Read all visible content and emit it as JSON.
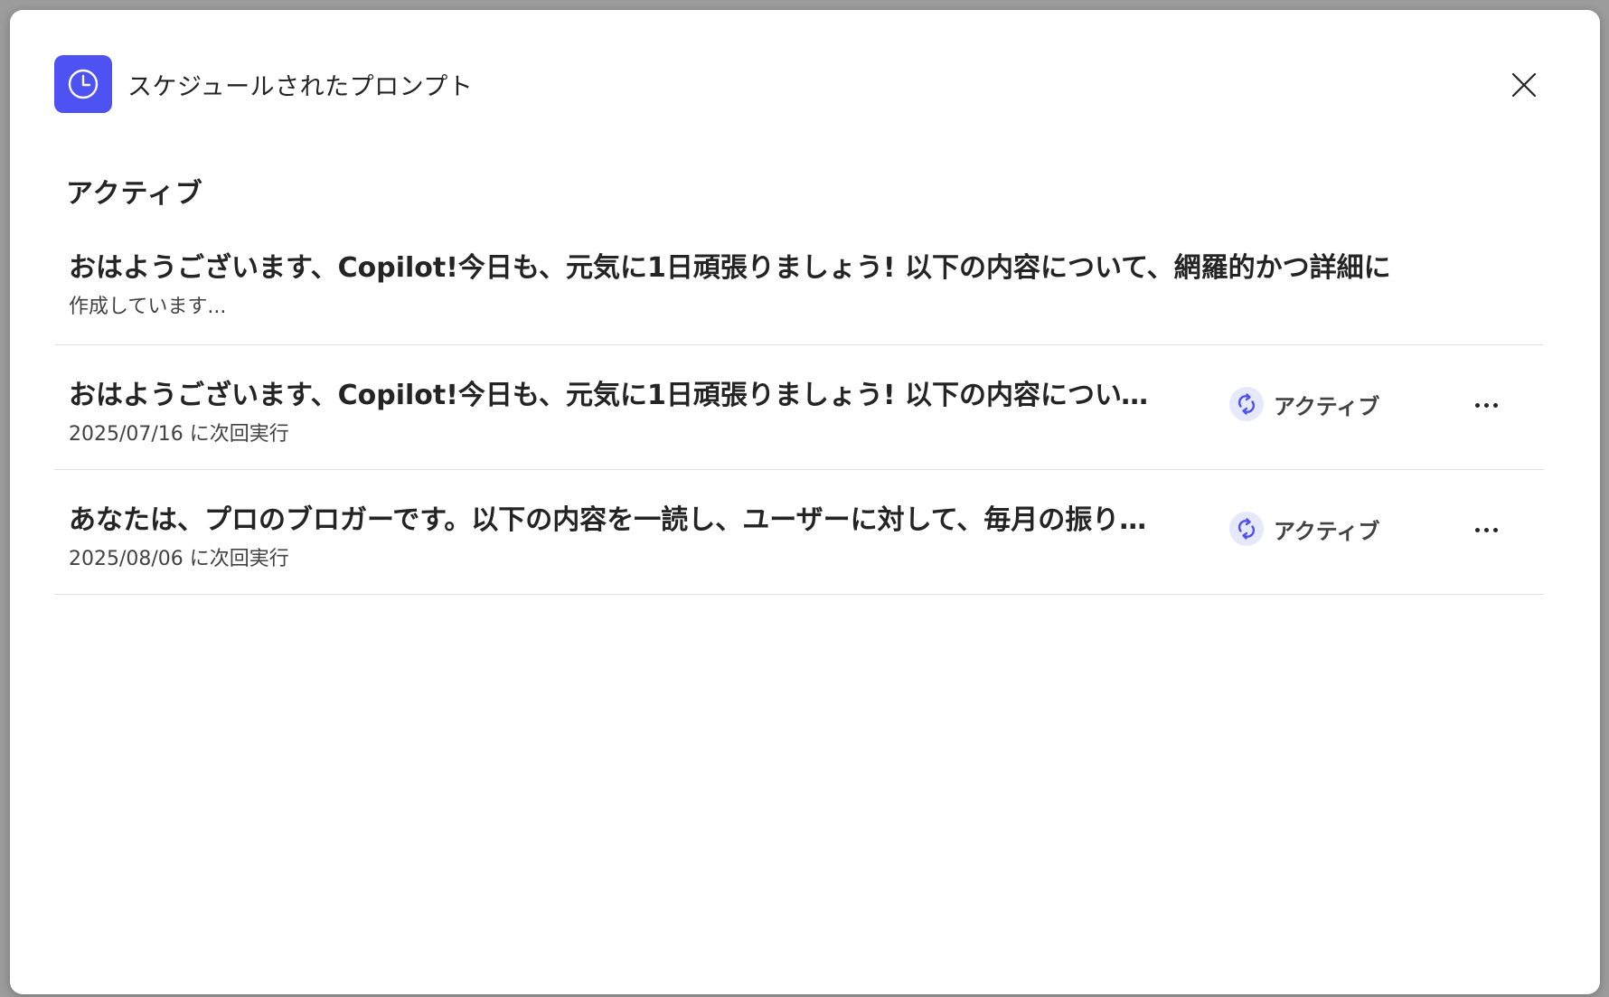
{
  "dialog": {
    "title": "スケジュールされたプロンプト",
    "icon": "clock-icon",
    "accent": "#4f52f2"
  },
  "section": {
    "title": "アクティブ"
  },
  "items": [
    {
      "title": "おはようございます、Copilot!今日も、元気に1日頑張りましょう! 以下の内容について、網羅的かつ詳細に",
      "subtitle": "作成しています..."
    },
    {
      "title": "おはようございます、Copilot!今日も、元気に1日頑張りましょう! 以下の内容について、網羅的かつ詳細に",
      "subtitle": "2025/07/16 に次回実行",
      "status": "アクティブ",
      "status_icon": "recurring-icon"
    },
    {
      "title": "あなたは、プロのブロガーです。以下の内容を一読し、ユーザーに対して、毎月の振り返りを",
      "subtitle": "2025/08/06 に次回実行",
      "status": "アクティブ",
      "status_icon": "recurring-icon"
    }
  ]
}
